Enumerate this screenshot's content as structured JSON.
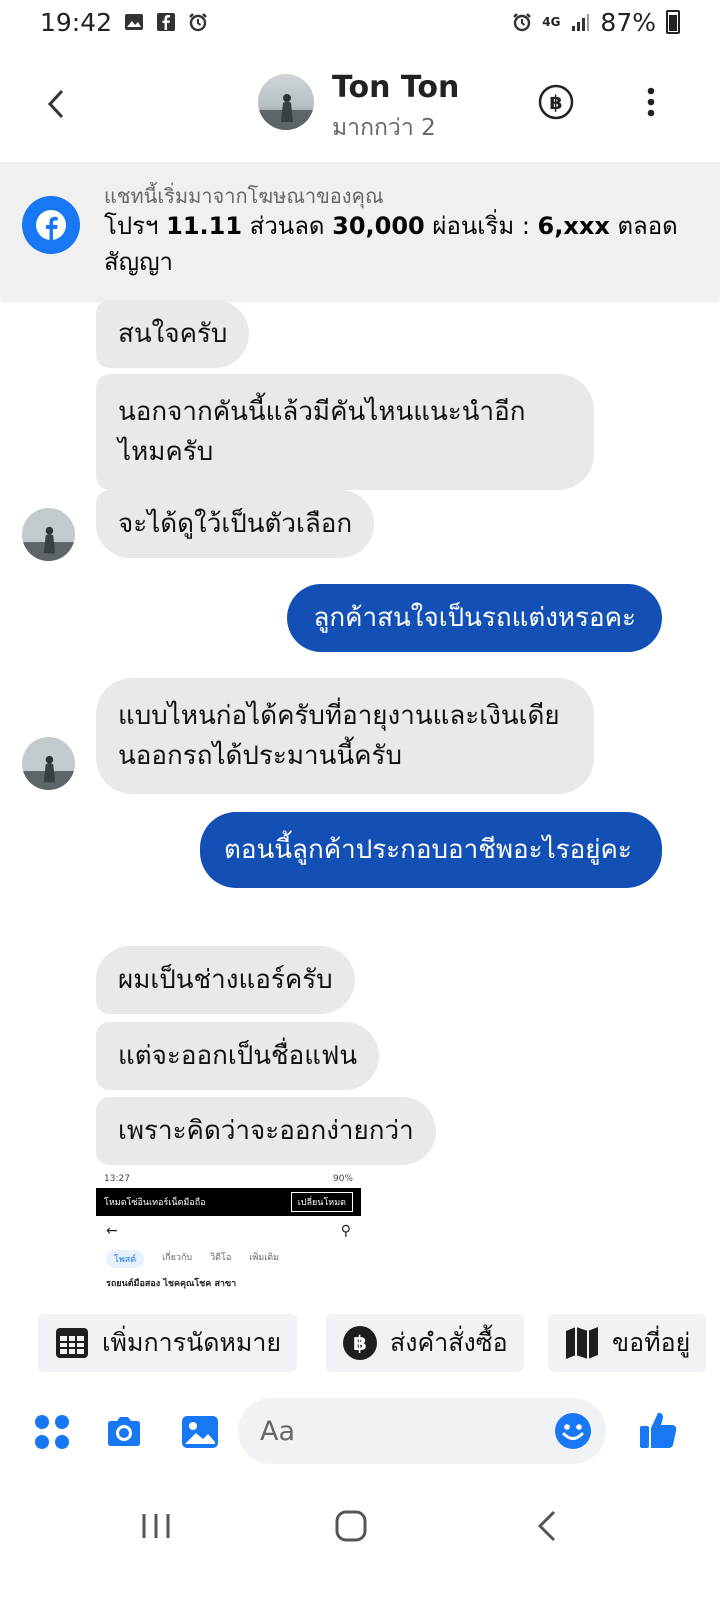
{
  "status_bar": {
    "time": "19:42",
    "network": "4G",
    "battery": "87%"
  },
  "header": {
    "name": "Ton Ton",
    "subtitle": "มากกว่า 2"
  },
  "ad": {
    "caption": "แชทนี้เริ่มมาจากโฆษณาของคุณ",
    "text_before": "โปรฯ ",
    "bold1": "11.11",
    "text_mid1": " ส่วนลด ",
    "bold2": "30,000",
    "text_mid2": " ผ่อนเริ่ม : ",
    "bold3": "6,xxx",
    "text_after": " ตลอดสัญญา"
  },
  "messages": [
    {
      "from": "them",
      "text": "สนใจครับ"
    },
    {
      "from": "them",
      "text": "นอกจากคันนี้แล้วมีคันไหนแนะนำอีกไหมครับ"
    },
    {
      "from": "them",
      "text": "จะได้ดูใว้เป็นตัวเลือก"
    },
    {
      "from": "me",
      "text": "ลูกค้าสนใจเป็นรถแต่งหรอคะ"
    },
    {
      "from": "them",
      "text": "แบบไหนก่อได้ครับที่อายุงานและเงินเดียนออกรถได้ประมานนี้ครับ"
    },
    {
      "from": "me",
      "text": "ตอนนี้ลูกค้าประกอบอาชีพอะไรอยู่คะ"
    },
    {
      "from": "them",
      "text": "ผมเป็นช่างแอร์ครับ"
    },
    {
      "from": "them",
      "text": "แต่จะออกเป็นชื่อแฟน"
    },
    {
      "from": "them",
      "text": "เพราะคิดว่าจะออกง่ายกว่า"
    }
  ],
  "shared_screenshot": {
    "time": "13:27",
    "battery": "90%",
    "bar_title": "โหมดโซ่อินเทอร์เน็ตมือถือ",
    "bar_button": "เปลี่ยนโหมด",
    "tabs": [
      "โพสต์",
      "เกี่ยวกับ",
      "วิดีโอ",
      "เพิ่มเติม"
    ],
    "post_title": "รถยนต์มือสอง ไชคคุณโชค สาขา"
  },
  "quick_replies": [
    "เพิ่มการนัดหมาย",
    "ส่งคำสั่งซื้อ",
    "ขอที่อยู่"
  ],
  "composer": {
    "placeholder": "Aa"
  },
  "colors": {
    "accent": "#1877f2",
    "outgoing": "#1350b5",
    "incoming": "#e9e9eb"
  }
}
